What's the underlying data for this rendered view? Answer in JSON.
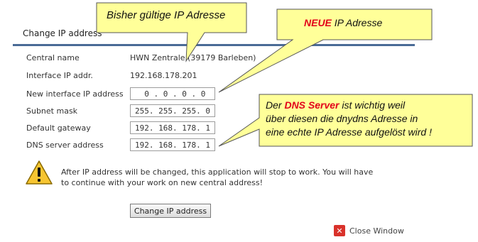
{
  "panel": {
    "title": "Change IP address"
  },
  "rows": [
    {
      "label": "Central name",
      "value": "HWN Zentrale (39179 Barleben)"
    },
    {
      "label": "Interface IP addr.",
      "value": "192.168.178.201"
    },
    {
      "label": "New interface IP address",
      "value": "  0 . 0 . 0 . 0"
    },
    {
      "label": "Subnet mask",
      "value": "255. 255. 255. 0"
    },
    {
      "label": "Default gateway",
      "value": "192. 168. 178. 1"
    },
    {
      "label": "DNS server address",
      "value": "192. 168. 178. 1"
    }
  ],
  "warning": {
    "icon": "warning-triangle-icon",
    "text": "After IP address will be changed, this application will stop to work. You will have to continue with your work on new central address!"
  },
  "actions": {
    "change_button": "Change IP address",
    "close_label": "Close Window",
    "close_icon": "close-x-icon"
  },
  "callouts": {
    "old_ip": "Bisher gültige IP Adresse",
    "new_ip_bold": "NEUE",
    "new_ip_rest": "IP Adresse",
    "dns_line1_pre": "Der ",
    "dns_line1_bold": "DNS Server",
    "dns_line1_post": " ist wichtig weil",
    "dns_line2": "über diesen die dnydns Adresse in",
    "dns_line3": "eine echte IP Adresse aufgelöst wird !"
  },
  "colors": {
    "callout_fill": "#ffff99",
    "accent_bar": "#4a6b96",
    "highlight": "#e2001a"
  }
}
